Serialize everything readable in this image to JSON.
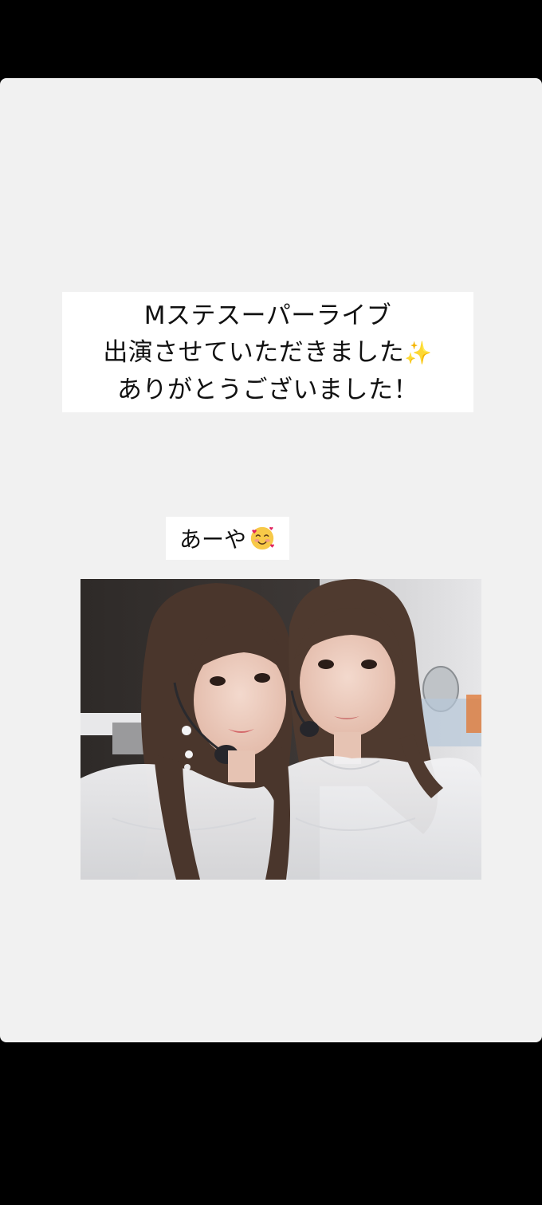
{
  "story": {
    "caption_lines": [
      "Mステスーパーライブ",
      "出演させていただきました",
      "ありがとうございました！"
    ],
    "caption_emoji": "✨",
    "name_tag": "あーや",
    "name_tag_emoji": "smiling-face-with-hearts-icon",
    "photo": "selfie-photo"
  },
  "colors": {
    "background": "#000000",
    "story_card": "#f1f1f1",
    "text_box": "#ffffff",
    "text": "#111111"
  }
}
